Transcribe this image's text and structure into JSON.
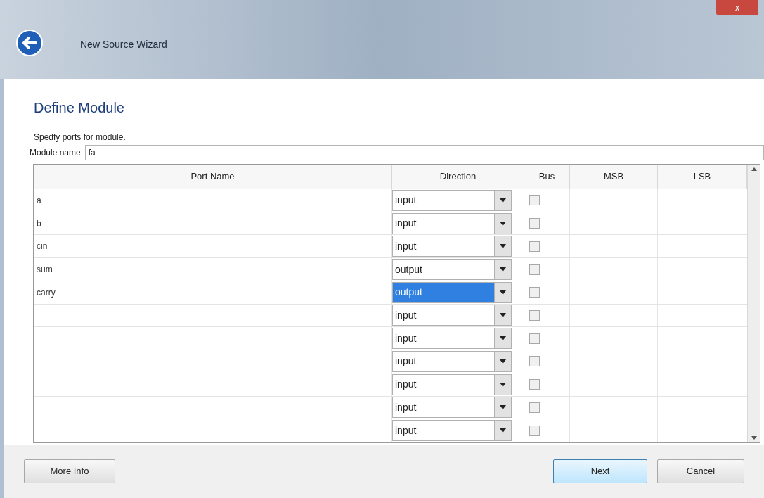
{
  "window": {
    "title": "New Source Wizard",
    "close": "x"
  },
  "page": {
    "heading": "Define Module",
    "instruction": "Spedfy ports for module.",
    "module_name": {
      "label": "Module name",
      "value": "fa"
    }
  },
  "table": {
    "columns": [
      "Port Name",
      "Direction",
      "Bus",
      "MSB",
      "LSB"
    ],
    "rows": [
      {
        "port_name": "a",
        "direction": "input",
        "selected": false,
        "bus": false
      },
      {
        "port_name": "b",
        "direction": "input",
        "selected": false,
        "bus": false
      },
      {
        "port_name": "cin",
        "direction": "input",
        "selected": false,
        "bus": false
      },
      {
        "port_name": "sum",
        "direction": "output",
        "selected": false,
        "bus": false
      },
      {
        "port_name": "carry",
        "direction": "output",
        "selected": true,
        "bus": false
      },
      {
        "port_name": "",
        "direction": "input",
        "selected": false,
        "bus": false
      },
      {
        "port_name": "",
        "direction": "input",
        "selected": false,
        "bus": false
      },
      {
        "port_name": "",
        "direction": "input",
        "selected": false,
        "bus": false
      },
      {
        "port_name": "",
        "direction": "input",
        "selected": false,
        "bus": false
      },
      {
        "port_name": "",
        "direction": "input",
        "selected": false,
        "bus": false
      },
      {
        "port_name": "",
        "direction": "input",
        "selected": false,
        "bus": false
      }
    ]
  },
  "buttons": {
    "more_info": "More Info",
    "next": "Next",
    "cancel": "Cancel"
  }
}
